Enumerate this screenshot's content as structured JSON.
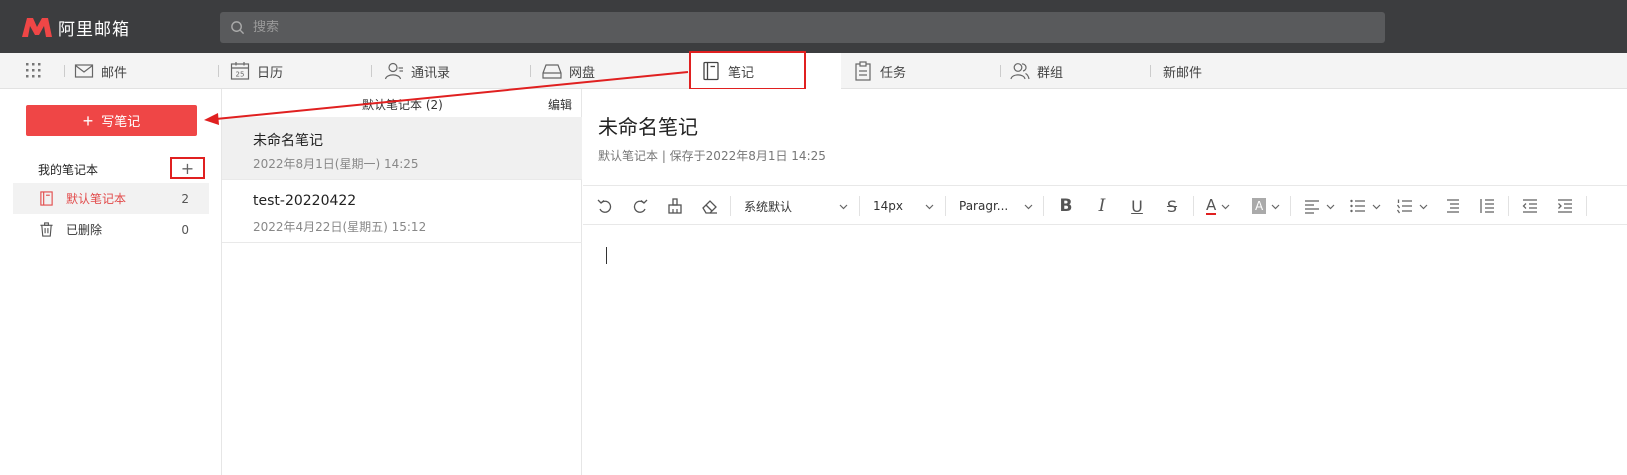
{
  "app": {
    "logo_text": "阿里邮箱"
  },
  "search": {
    "placeholder": "搜索"
  },
  "nav": {
    "items": [
      {
        "label": "邮件"
      },
      {
        "label": "日历"
      },
      {
        "label": "通讯录"
      },
      {
        "label": "网盘"
      },
      {
        "label": "笔记"
      },
      {
        "label": "任务"
      },
      {
        "label": "群组"
      },
      {
        "label": "新邮件"
      }
    ],
    "calendar_day": "25"
  },
  "sidebar": {
    "compose_label": "写笔记",
    "notebooks_header": "我的笔记本",
    "add_symbol": "+",
    "items": [
      {
        "label": "默认笔记本",
        "count": "2"
      },
      {
        "label": "已删除",
        "count": "0"
      }
    ]
  },
  "list": {
    "title": "默认笔记本 (2)",
    "edit_label": "编辑",
    "notes": [
      {
        "title": "未命名笔记",
        "date": "2022年8月1日(星期一) 14:25"
      },
      {
        "title": "test-20220422",
        "date": "2022年4月22日(星期五) 15:12"
      }
    ]
  },
  "editor": {
    "title": "未命名笔记",
    "meta": "默认笔记本 | 保存于2022年8月1日 14:25",
    "toolbar": {
      "font_family": "系统默认",
      "font_size": "14px",
      "paragraph": "Paragr...",
      "bold": "B",
      "italic": "I",
      "underline": "U",
      "strike": "S",
      "text_color": "A",
      "bg_color": "A"
    }
  },
  "colors": {
    "accent": "#ef4646",
    "highlight": "#e02020",
    "topbar": "#3c3d3f"
  }
}
